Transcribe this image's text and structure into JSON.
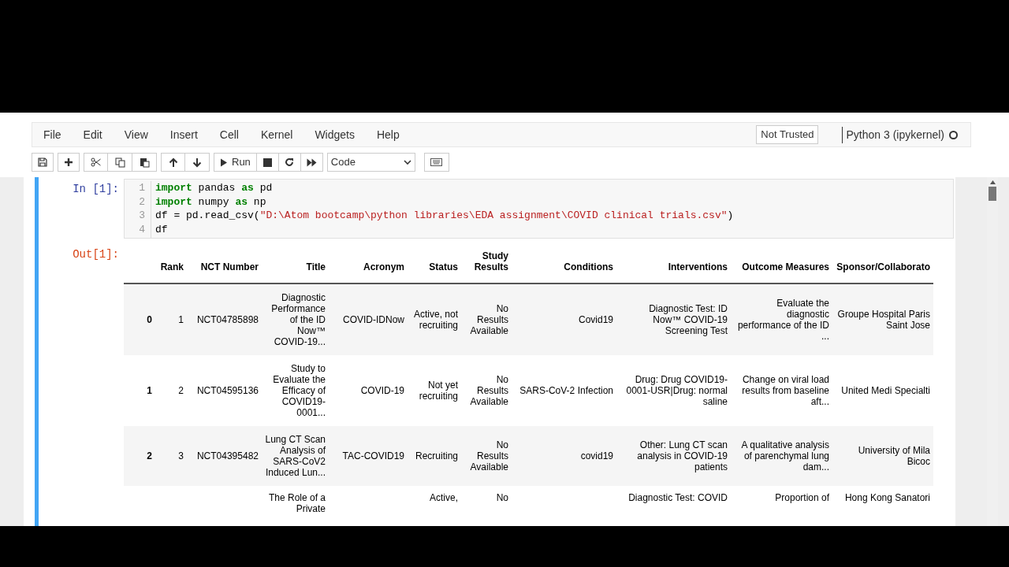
{
  "menu": [
    "File",
    "Edit",
    "View",
    "Insert",
    "Cell",
    "Kernel",
    "Widgets",
    "Help"
  ],
  "trust": "Not Trusted",
  "kernel": {
    "name": "Python 3 (ipykernel)",
    "busy": false
  },
  "toolbar": {
    "run": "Run",
    "cell_type": "Code"
  },
  "cell": {
    "prompt": "In [1]:",
    "out_prompt": "Out[1]:",
    "selected": true,
    "line_numbers": [
      "1",
      "2",
      "3",
      "4"
    ],
    "lines": [
      [
        {
          "t": "import",
          "kind": "keyword"
        },
        {
          "t": " pandas ",
          "kind": "plain"
        },
        {
          "t": "as",
          "kind": "keyword"
        },
        {
          "t": " pd",
          "kind": "plain"
        }
      ],
      [
        {
          "t": "import",
          "kind": "keyword"
        },
        {
          "t": " numpy ",
          "kind": "plain"
        },
        {
          "t": "as",
          "kind": "keyword"
        },
        {
          "t": " np",
          "kind": "plain"
        }
      ],
      [
        {
          "t": "df = pd.read_csv(",
          "kind": "plain"
        },
        {
          "t": "\"D:\\Atom bootcamp\\python libraries\\EDA assignment\\COVID clinical trials.csv\"",
          "kind": "string"
        },
        {
          "t": ")",
          "kind": "plain"
        }
      ],
      [
        {
          "t": "df",
          "kind": "plain"
        }
      ]
    ]
  },
  "table": {
    "columns": [
      "",
      "Rank",
      "NCT Number",
      "Title",
      "Acronym",
      "Status",
      "Study Results",
      "Conditions",
      "Interventions",
      "Outcome Measures",
      "Sponsor/Collaborato"
    ],
    "rows": [
      [
        "0",
        "1",
        "NCT04785898",
        "Diagnostic Performance of the ID Now™ COVID-19...",
        "COVID-IDNow",
        "Active, not recruiting",
        "No Results Available",
        "Covid19",
        "Diagnostic Test: ID Now™ COVID-19 Screening Test",
        "Evaluate the diagnostic performance of the ID ...",
        "Groupe Hospital Paris Saint Jose"
      ],
      [
        "1",
        "2",
        "NCT04595136",
        "Study to Evaluate the Efficacy of COVID19-0001...",
        "COVID-19",
        "Not yet recruiting",
        "No Results Available",
        "SARS-CoV-2 Infection",
        "Drug: Drug COVID19-0001-USR|Drug: normal saline",
        "Change on viral load results from baseline aft...",
        "United Medi Specialti"
      ],
      [
        "2",
        "3",
        "NCT04395482",
        "Lung CT Scan Analysis of SARS-CoV2 Induced Lun...",
        "TAC-COVID19",
        "Recruiting",
        "No Results Available",
        "covid19",
        "Other: Lung CT scan analysis in COVID-19 patients",
        "A qualitative analysis of parenchymal lung dam...",
        "University of Mila Bicoc"
      ],
      [
        "",
        "",
        "",
        "The Role of a Private",
        "",
        "Active,",
        "No",
        "",
        "Diagnostic Test: COVID",
        "Proportion of",
        "Hong Kong Sanatori"
      ]
    ]
  }
}
